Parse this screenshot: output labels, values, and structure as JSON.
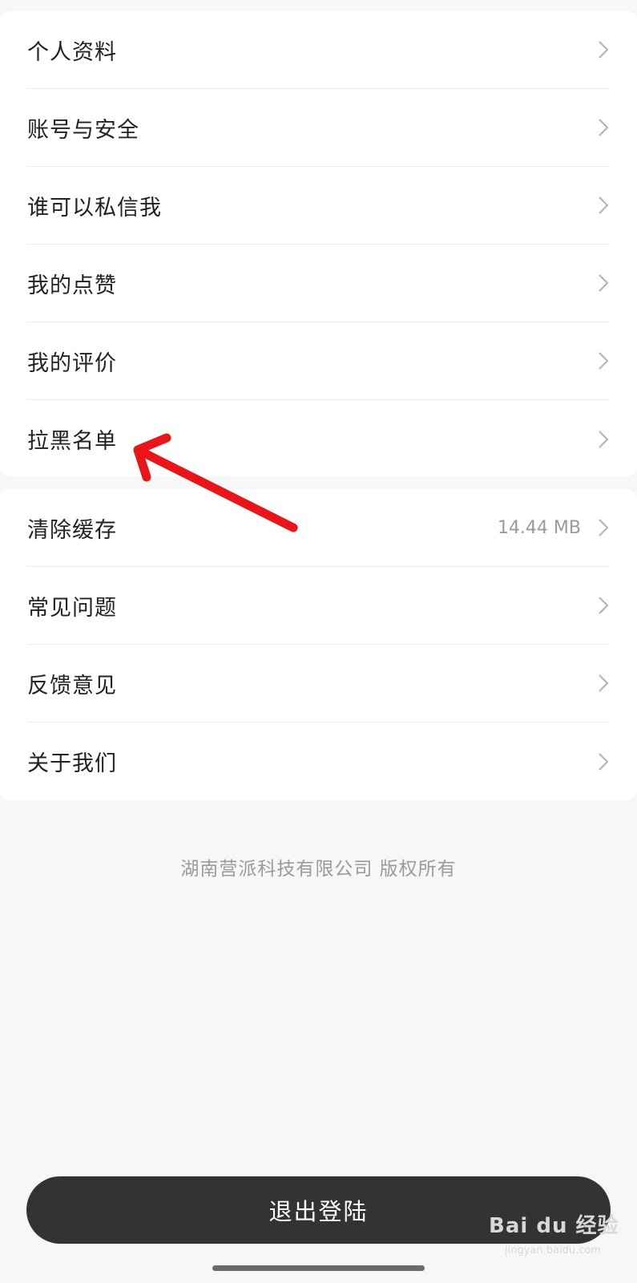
{
  "settings_group_1": [
    {
      "label": "个人资料"
    },
    {
      "label": "账号与安全"
    },
    {
      "label": "谁可以私信我"
    },
    {
      "label": "我的点赞"
    },
    {
      "label": "我的评价"
    },
    {
      "label": "拉黑名单"
    }
  ],
  "settings_group_2": [
    {
      "label": "清除缓存",
      "value": "14.44 MB"
    },
    {
      "label": "常见问题"
    },
    {
      "label": "反馈意见"
    },
    {
      "label": "关于我们"
    }
  ],
  "footer": {
    "copyright": "湖南营派科技有限公司 版权所有"
  },
  "logout_button": {
    "label": "退出登陆"
  },
  "watermark": {
    "text": "Bai du 经验",
    "url": "jingyan.baidu.com"
  },
  "icons": {
    "row_arrow": "chevron-right-icon",
    "annotation": "red-arrow-annotation"
  },
  "colors": {
    "background": "#f7f7f7",
    "card": "#ffffff",
    "logout_bg": "#333333",
    "annotation": "#e8161b"
  }
}
